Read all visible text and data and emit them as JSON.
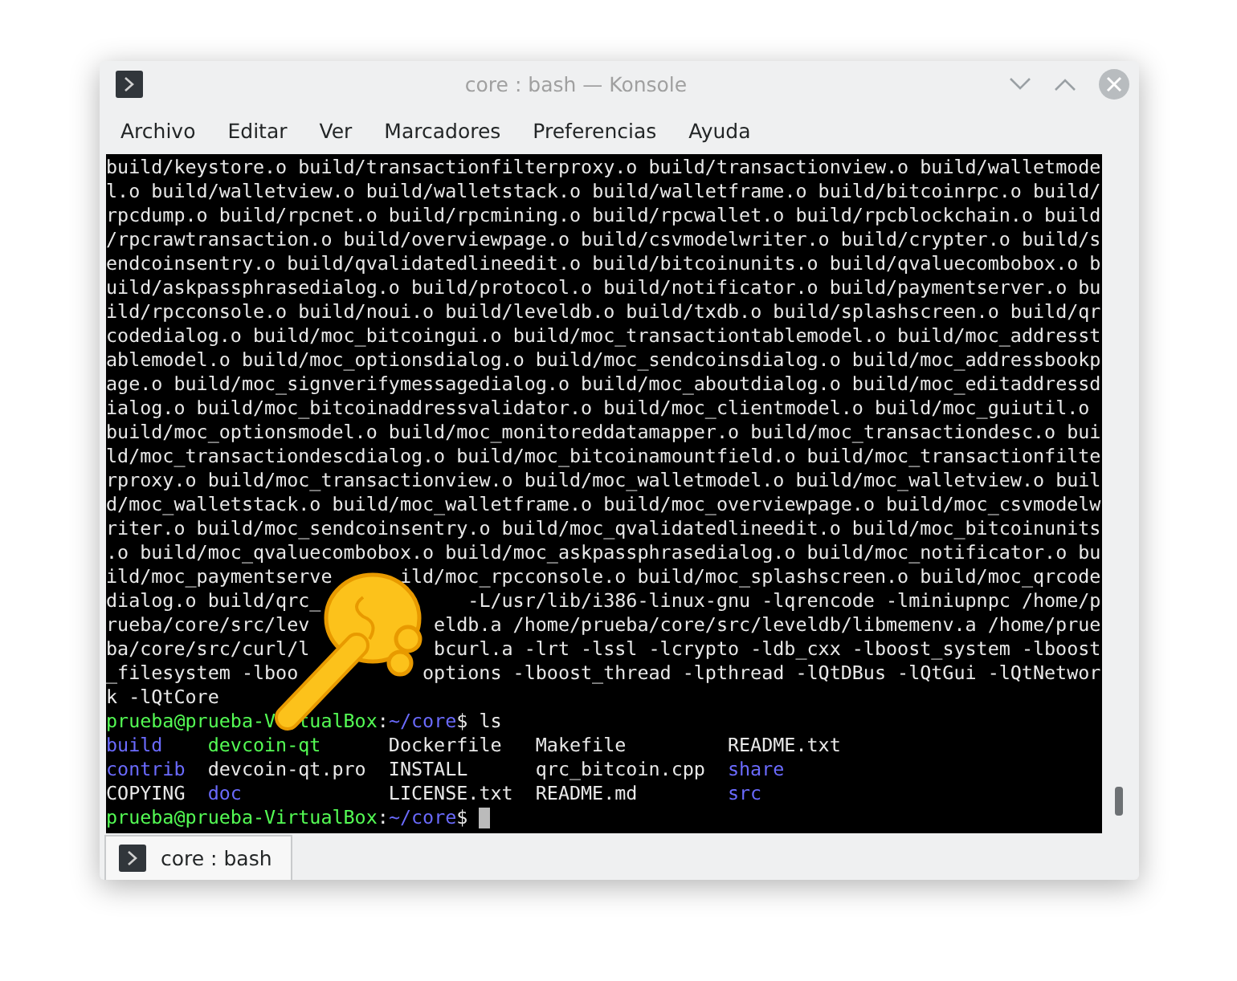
{
  "window": {
    "title": "core : bash — Konsole"
  },
  "menu": [
    "Archivo",
    "Editar",
    "Ver",
    "Marcadores",
    "Preferencias",
    "Ayuda"
  ],
  "terminal": {
    "lines": [
      {
        "kind": "output",
        "segments": [
          {
            "text": "build/keystore.o build/transactionfilterproxy.o build/transactionview.o build/walletmode"
          }
        ]
      },
      {
        "kind": "output",
        "segments": [
          {
            "text": "l.o build/walletview.o build/walletstack.o build/walletframe.o build/bitcoinrpc.o build/"
          }
        ]
      },
      {
        "kind": "output",
        "segments": [
          {
            "text": "rpcdump.o build/rpcnet.o build/rpcmining.o build/rpcwallet.o build/rpcblockchain.o build"
          }
        ]
      },
      {
        "kind": "output",
        "segments": [
          {
            "text": "/rpcrawtransaction.o build/overviewpage.o build/csvmodelwriter.o build/crypter.o build/s"
          }
        ]
      },
      {
        "kind": "output",
        "segments": [
          {
            "text": "endcoinsentry.o build/qvalidatedlineedit.o build/bitcoinunits.o build/qvaluecombobox.o b"
          }
        ]
      },
      {
        "kind": "output",
        "segments": [
          {
            "text": "uild/askpassphrasedialog.o build/protocol.o build/notificator.o build/paymentserver.o bu"
          }
        ]
      },
      {
        "kind": "output",
        "segments": [
          {
            "text": "ild/rpcconsole.o build/noui.o build/leveldb.o build/txdb.o build/splashscreen.o build/qr"
          }
        ]
      },
      {
        "kind": "output",
        "segments": [
          {
            "text": "codedialog.o build/moc_bitcoingui.o build/moc_transactiontablemodel.o build/moc_addresst"
          }
        ]
      },
      {
        "kind": "output",
        "segments": [
          {
            "text": "ablemodel.o build/moc_optionsdialog.o build/moc_sendcoinsdialog.o build/moc_addressbookp"
          }
        ]
      },
      {
        "kind": "output",
        "segments": [
          {
            "text": "age.o build/moc_signverifymessagedialog.o build/moc_aboutdialog.o build/moc_editaddressd"
          }
        ]
      },
      {
        "kind": "output",
        "segments": [
          {
            "text": "ialog.o build/moc_bitcoinaddressvalidator.o build/moc_clientmodel.o build/moc_guiutil.o"
          }
        ]
      },
      {
        "kind": "output",
        "segments": [
          {
            "text": "build/moc_optionsmodel.o build/moc_monitoreddatamapper.o build/moc_transactiondesc.o bui"
          }
        ]
      },
      {
        "kind": "output",
        "segments": [
          {
            "text": "ld/moc_transactiondescdialog.o build/moc_bitcoinamountfield.o build/moc_transactionfilte"
          }
        ]
      },
      {
        "kind": "output",
        "segments": [
          {
            "text": "rproxy.o build/moc_transactionview.o build/moc_walletmodel.o build/moc_walletview.o buil"
          }
        ]
      },
      {
        "kind": "output",
        "segments": [
          {
            "text": "d/moc_walletstack.o build/moc_walletframe.o build/moc_overviewpage.o build/moc_csvmodelw"
          }
        ]
      },
      {
        "kind": "output",
        "segments": [
          {
            "text": "riter.o build/moc_sendcoinsentry.o build/moc_qvalidatedlineedit.o build/moc_bitcoinunits"
          }
        ]
      },
      {
        "kind": "output",
        "segments": [
          {
            "text": ".o build/moc_qvaluecombobox.o build/moc_askpassphrasedialog.o build/moc_notificator.o bu"
          }
        ]
      },
      {
        "kind": "output",
        "segments": [
          {
            "text": "ild/moc_paymentserve"
          },
          {
            "text": "ild/moc_rpcconsole.o build/moc_splashscreen.o build/moc_qrcode"
          }
        ]
      },
      {
        "kind": "output",
        "segments": [
          {
            "text": "dialog.o build/qrc_"
          },
          {
            "text": "-L/usr/lib/i386-linux-gnu -lqrencode -lminiupnpc /home/p"
          }
        ]
      },
      {
        "kind": "output",
        "segments": [
          {
            "text": "rueba/core/src/lev"
          },
          {
            "text": "eldb.a /home/prueba/core/src/leveldb/libmemenv.a /home/prue"
          }
        ]
      },
      {
        "kind": "output",
        "segments": [
          {
            "text": "ba/core/src/curl/l"
          },
          {
            "text": "bcurl.a -lrt -lssl -lcrypto -ldb_cxx -lboost_system -lboost"
          }
        ]
      },
      {
        "kind": "output",
        "segments": [
          {
            "text": "_filesystem -lboo"
          },
          {
            "text": "options -lboost_thread -lpthread -lQtDBus -lQtGui -lQtNetwor"
          }
        ]
      },
      {
        "kind": "output",
        "segments": [
          {
            "text": "k -lQtCore"
          }
        ]
      },
      {
        "kind": "prompt",
        "cursor": false,
        "user_host": [
          "prueba@prueba-V",
          "tualBox"
        ],
        "separator": ":",
        "path": "~/core",
        "command": "$ ls"
      },
      {
        "kind": "listing",
        "cells": [
          {
            "text": "build",
            "kind": "directory"
          },
          {
            "text": "devcoin-qt",
            "kind": "executable"
          },
          {
            "text": "Dockerfile",
            "kind": "file"
          },
          {
            "text": "Makefile",
            "kind": "file"
          },
          {
            "text": "README.txt",
            "kind": "file"
          }
        ]
      },
      {
        "kind": "listing",
        "cells": [
          {
            "text": "contrib",
            "kind": "directory"
          },
          {
            "text": "devcoin-qt.pro",
            "kind": "file"
          },
          {
            "text": "INSTALL",
            "kind": "file"
          },
          {
            "text": "qrc_bitcoin.cpp",
            "kind": "file"
          },
          {
            "text": "share",
            "kind": "directory"
          }
        ]
      },
      {
        "kind": "listing",
        "cells": [
          {
            "text": "COPYING",
            "kind": "file"
          },
          {
            "text": "doc",
            "kind": "directory"
          },
          {
            "text": "LICENSE.txt",
            "kind": "file"
          },
          {
            "text": "README.md",
            "kind": "file"
          },
          {
            "text": "src",
            "kind": "directory"
          }
        ]
      },
      {
        "kind": "prompt",
        "cursor": true,
        "user_host": [
          "prueba@prueba-VirtualBox"
        ],
        "separator": ":",
        "path": "~/core",
        "command": "$"
      }
    ]
  },
  "tabs": [
    {
      "label": "core : bash",
      "selected": true
    }
  ]
}
